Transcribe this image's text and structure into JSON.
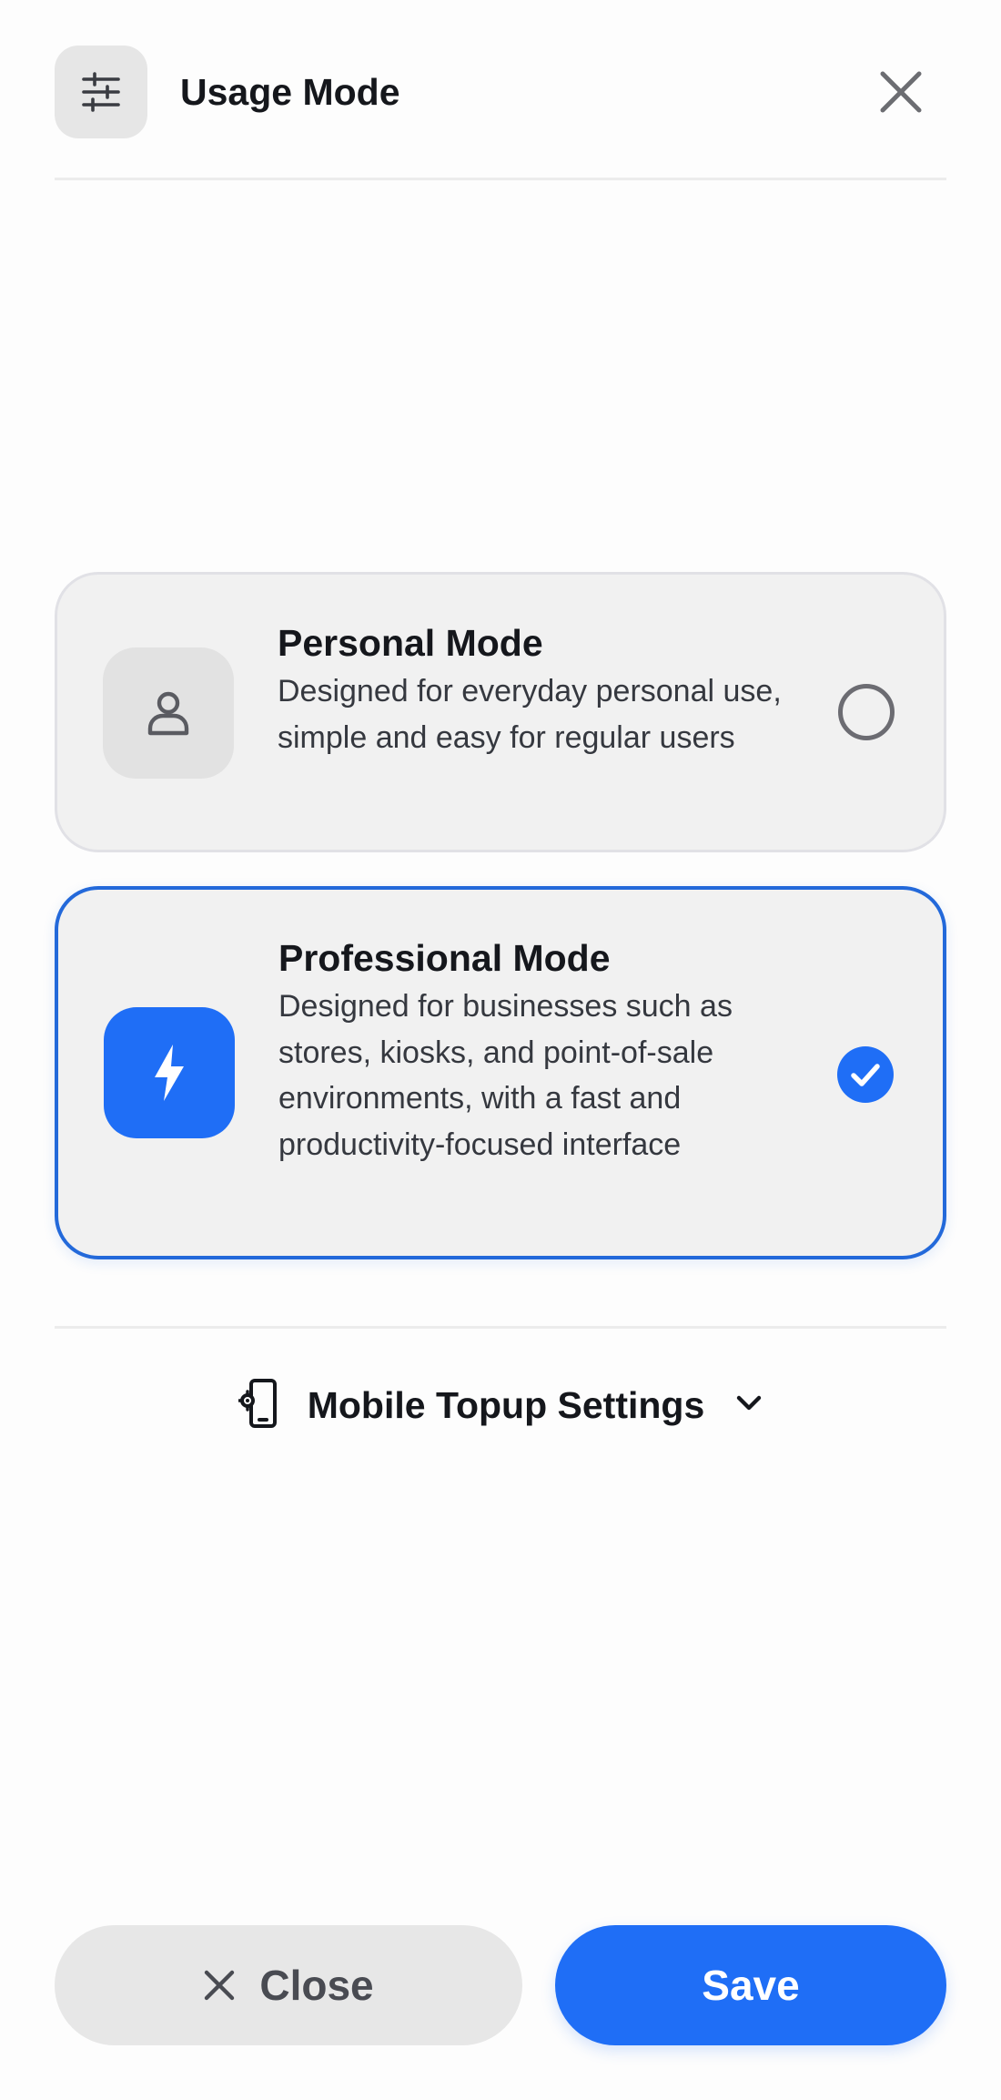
{
  "header": {
    "title": "Usage Mode",
    "icon": "sliders-icon",
    "close_icon": "close-icon"
  },
  "modes": [
    {
      "title": "Personal Mode",
      "description": "Designed for everyday personal use, simple and easy for regular users",
      "icon": "person-icon",
      "selected": false
    },
    {
      "title": "Professional Mode",
      "description": "Designed for businesses such as stores, kiosks, and point-of-sale environments, with a fast and productivity-focused interface",
      "icon": "lightning-icon",
      "selected": true
    }
  ],
  "topup": {
    "label": "Mobile Topup Settings",
    "icon": "phone-settings-icon",
    "expand_icon": "chevron-down-icon"
  },
  "footer": {
    "close_label": "Close",
    "save_label": "Save"
  },
  "colors": {
    "accent": "#1f6ef6",
    "selected_border": "#2369da",
    "card_bg": "#f1f1f1",
    "close_button_bg": "#e7e7e7"
  }
}
